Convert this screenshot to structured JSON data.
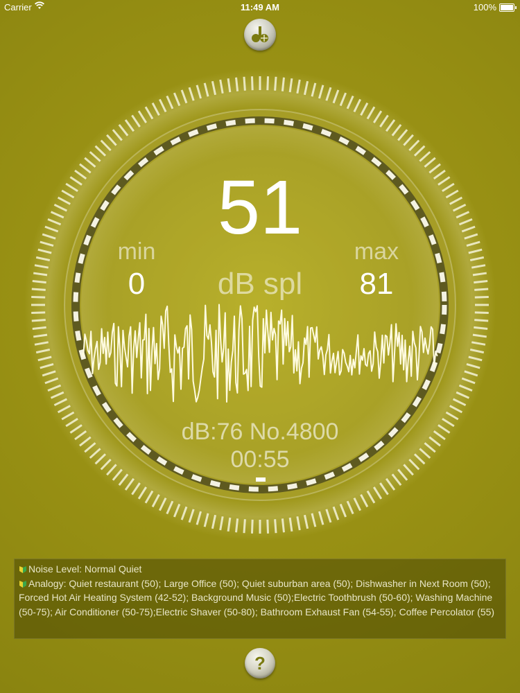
{
  "status_bar": {
    "carrier": "Carrier",
    "time": "11:49 AM",
    "battery": "100%",
    "wifi_icon": "wifi-icon",
    "battery_icon": "battery-icon"
  },
  "header": {
    "logo_icon": "app-logo-icon"
  },
  "meter": {
    "value": "51",
    "unit": "dB spl",
    "min_label": "min",
    "min_value": "0",
    "max_label": "max",
    "max_value": "81",
    "sample": "dB:76 No.4800",
    "timer": "00:55"
  },
  "info": {
    "noise_level": "Noise Level: Normal Quiet",
    "analogy": "Analogy: Quiet restaurant (50); Large Office (50); Quiet suburban area (50); Dishwasher in Next Room (50); Forced Hot Air Heating System (42-52); Background Music (50);Electric Toothbrush (50-60); Washing Machine (50-75); Air Conditioner (50-75);Electric Shaver (50-80); Bathroom Exhaust Fan (54-55); Coffee Percolator (55)",
    "leaf_icon": "beginner-leaf-icon"
  },
  "footer": {
    "help_label": "?"
  },
  "colors": {
    "background": "#9a9214",
    "ring": "#f0efe0",
    "waveform": "#fffbe0"
  }
}
